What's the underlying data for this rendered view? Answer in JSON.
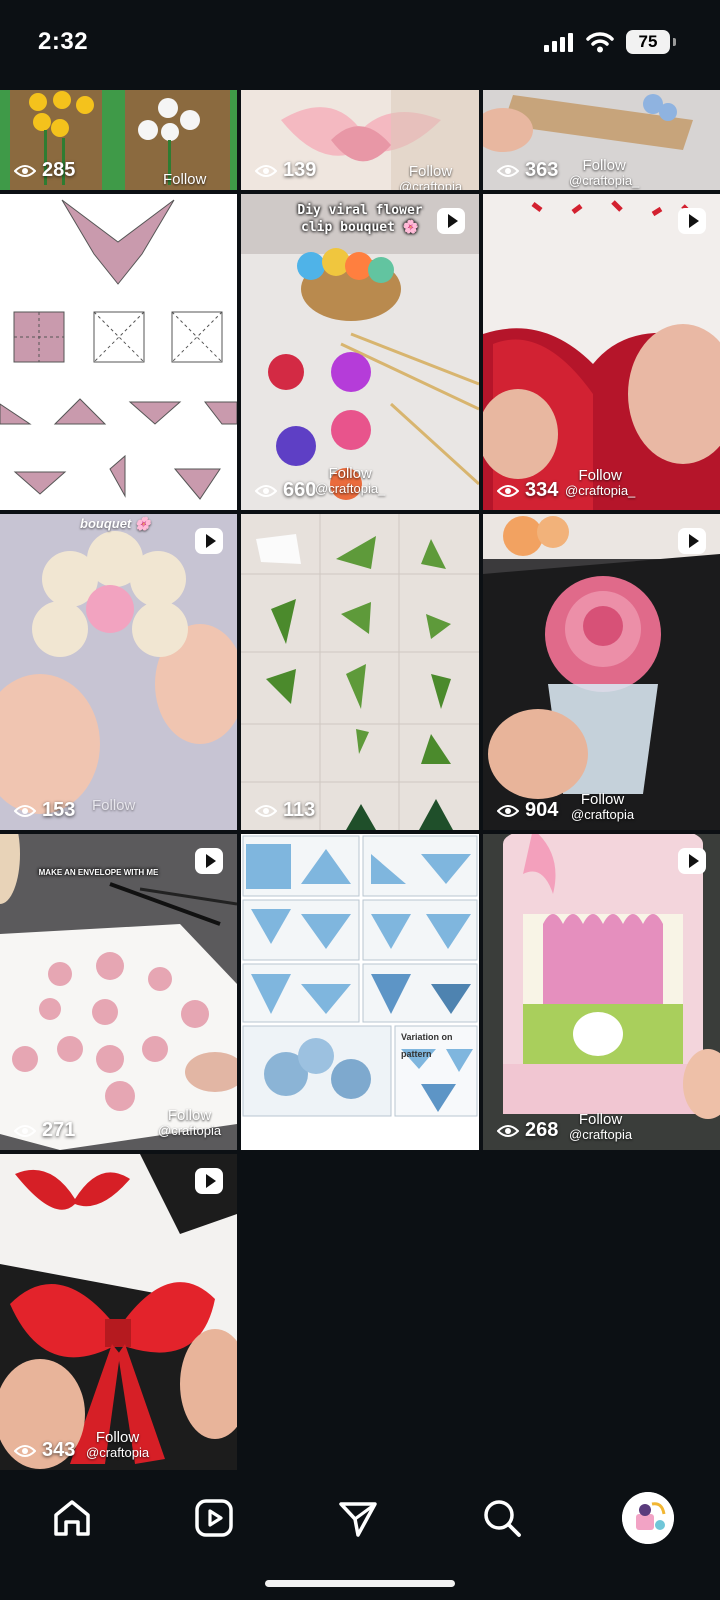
{
  "status_bar": {
    "time": "2:32",
    "battery": "75",
    "icons": [
      "signal-icon",
      "wifi-icon",
      "battery-icon"
    ]
  },
  "grid": {
    "tiles": [
      {
        "views": "285",
        "follow": "Follow",
        "handle": "",
        "reel": false
      },
      {
        "views": "139",
        "follow": "Follow",
        "handle": "@craftopia",
        "reel": false
      },
      {
        "views": "363",
        "follow": "Follow",
        "handle": "@craftopia_",
        "reel": false
      },
      {
        "views": "",
        "follow": "",
        "handle": "",
        "reel": false
      },
      {
        "views": "660",
        "follow": "Follow",
        "handle": "@craftopia_",
        "reel": true,
        "overlay": "Diy viral flower clip bouquet 🌸"
      },
      {
        "views": "334",
        "follow": "Follow",
        "handle": "@craftopia_",
        "reel": true
      },
      {
        "views": "153",
        "follow": "Follow",
        "handle": "@craftopia",
        "reel": true,
        "overlay": "bouquet 🌸"
      },
      {
        "views": "113",
        "follow": "",
        "handle": "",
        "reel": false
      },
      {
        "views": "904",
        "follow": "Follow",
        "handle": "@craftopia",
        "reel": true
      },
      {
        "views": "271",
        "follow": "Follow",
        "handle": "@craftopia",
        "reel": true,
        "overlay": "MAKE AN ENVELOPE WITH ME"
      },
      {
        "views": "",
        "follow": "",
        "handle": "",
        "reel": false,
        "overlay": "Variation on pattern"
      },
      {
        "views": "268",
        "follow": "Follow",
        "handle": "@craftopia",
        "reel": true
      },
      {
        "views": "343",
        "follow": "Follow",
        "handle": "@craftopia",
        "reel": true
      }
    ]
  },
  "nav": {
    "items": [
      "home-icon",
      "reels-icon",
      "send-icon",
      "search-icon",
      "profile-avatar"
    ]
  },
  "colors": {
    "background": "#0c1014",
    "text": "#ffffff"
  }
}
